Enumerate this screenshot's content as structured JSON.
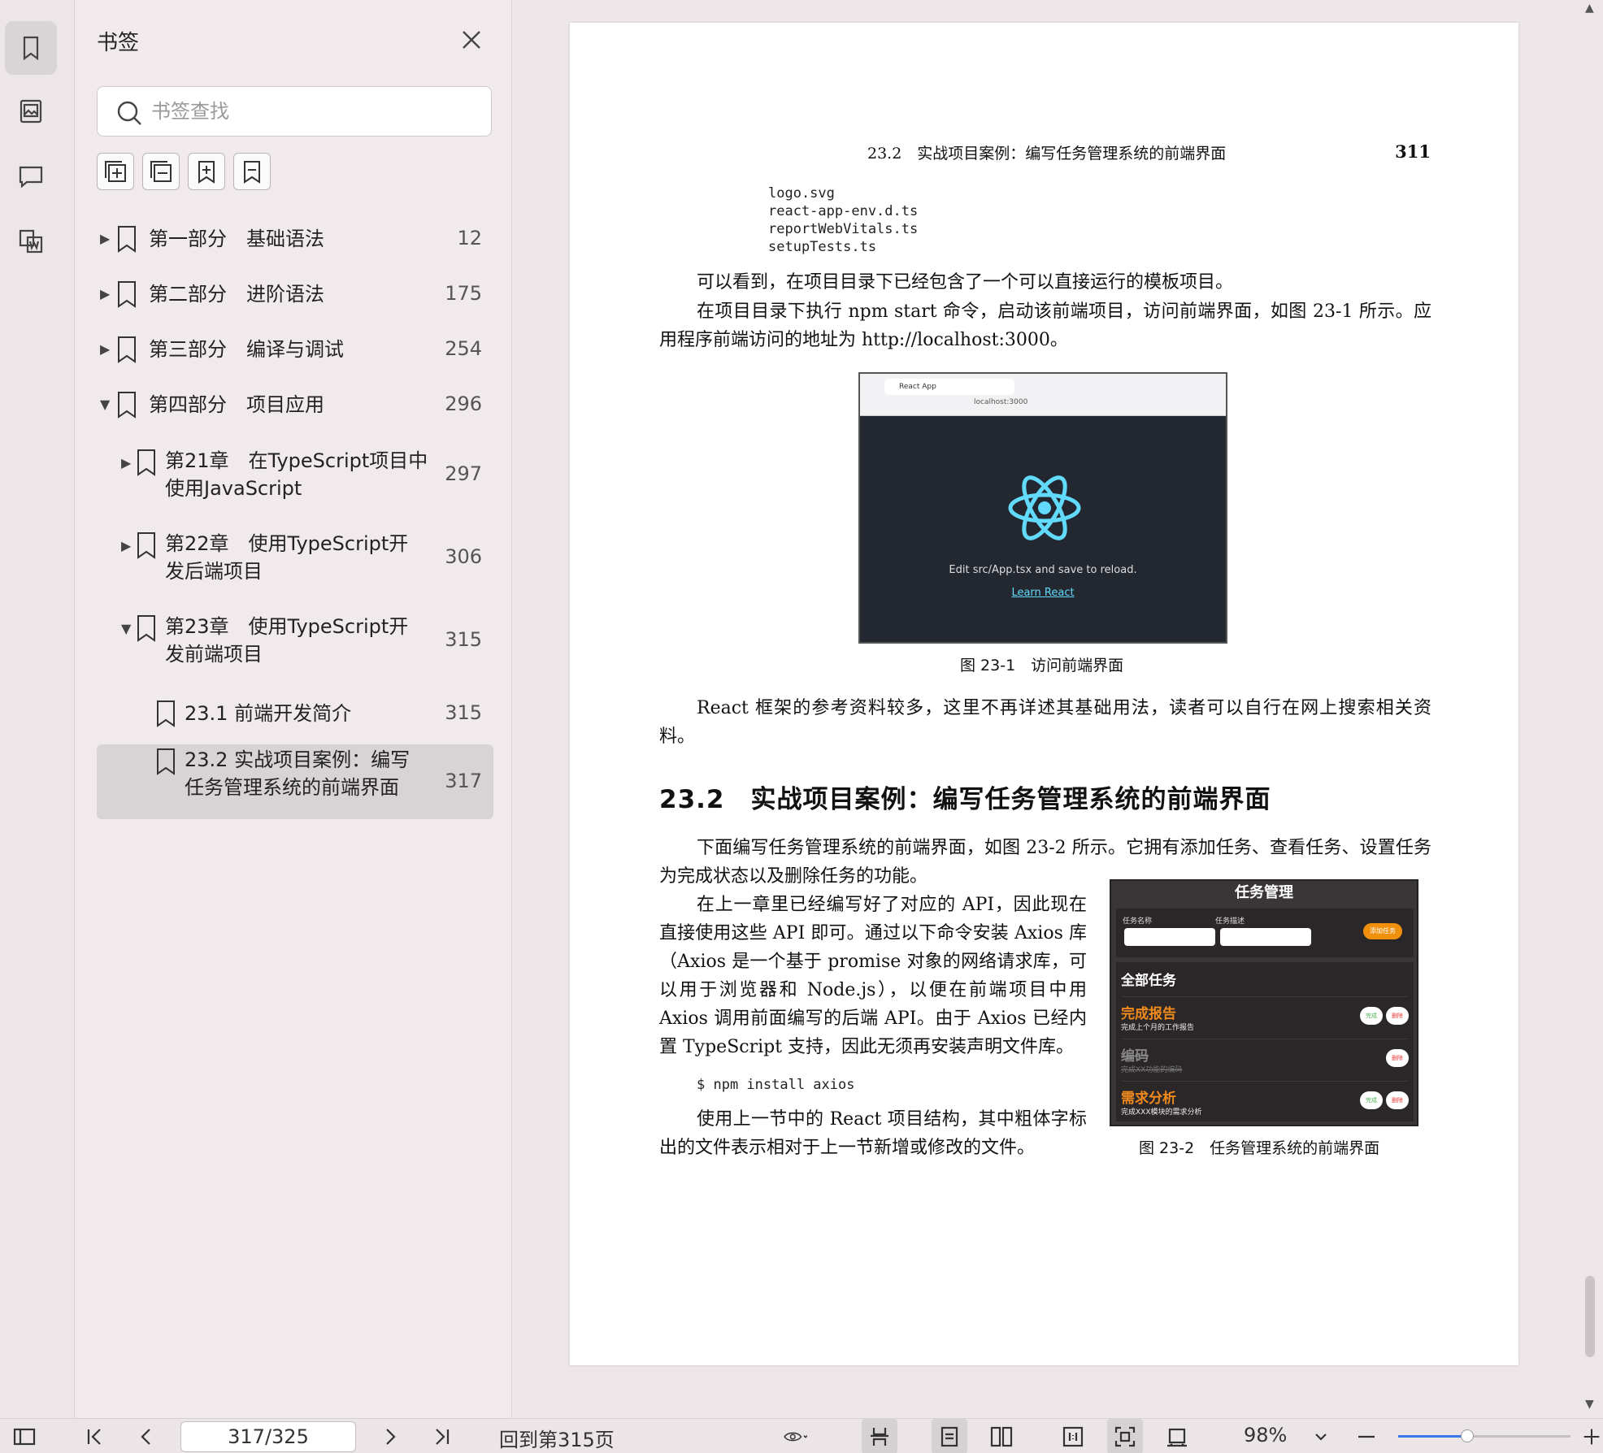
{
  "panel": {
    "title": "书签",
    "search_placeholder": "书签查找",
    "tree": [
      {
        "label": "第一部分　基础语法",
        "page": "12",
        "arrow": "right",
        "level": 0
      },
      {
        "label": "第二部分　进阶语法",
        "page": "175",
        "arrow": "right",
        "level": 0
      },
      {
        "label": "第三部分　编译与调试",
        "page": "254",
        "arrow": "right",
        "level": 0
      },
      {
        "label": "第四部分　项目应用",
        "page": "296",
        "arrow": "down",
        "level": 0
      },
      {
        "label": "第21章　在TypeScript项目中\n使用JavaScript",
        "page": "297",
        "arrow": "right",
        "level": 1
      },
      {
        "label": "第22章　使用TypeScript开\n发后端项目",
        "page": "306",
        "arrow": "right",
        "level": 1
      },
      {
        "label": "第23章　使用TypeScript开\n发前端项目",
        "page": "315",
        "arrow": "down",
        "level": 1
      },
      {
        "label": "23.1 前端开发简介",
        "page": "315",
        "arrow": "",
        "level": 2
      },
      {
        "label": "23.2 实战项目案例：编写\n任务管理系统的前端界面",
        "page": "317",
        "arrow": "",
        "level": 2,
        "selected": true
      }
    ]
  },
  "page": {
    "header": "23.2　实战项目案例：编写任务管理系统的前端界面",
    "number": "311",
    "code_lines": [
      "logo.svg",
      "react-app-env.d.ts",
      "reportWebVitals.ts",
      "setupTests.ts"
    ],
    "p1": "可以看到，在项目目录下已经包含了一个可以直接运行的模板项目。",
    "p2": "在项目目录下执行 npm start 命令，启动该前端项目，访问前端界面，如图 23-1 所示。应用程序前端访问的地址为 http://localhost:3000。",
    "fig1": {
      "tab": "React App",
      "url": "localhost:3000",
      "edit_text": "Edit src/App.tsx and save to reload.",
      "link": "Learn React",
      "caption": "图 23-1　访问前端界面"
    },
    "p3": "React 框架的参考资料较多，这里不再详述其基础用法，读者可以自行在网上搜索相关资料。",
    "section_title": "23.2　实战项目案例：编写任务管理系统的前端界面",
    "p4": "下面编写任务管理系统的前端界面，如图 23-2 所示。它拥有添加任务、查看任务、设置任务为完成状态以及删除任务的功能。",
    "p5": "在上一章里已经编写好了对应的 API，因此现在直接使用这些 API 即可。通过以下命令安装 Axios 库（Axios 是一个基于 promise 对象的网络请求库，可以用于浏览器和 Node.js），以便在前端项目中用 Axios 调用前面编写的后端 API。由于 Axios 已经内置 TypeScript 支持，因此无须再安装声明文件库。",
    "cmd": "$ npm install axios",
    "p6": "使用上一节中的 React 项目结构，其中粗体字标出的文件表示相对于上一节新增或修改的文件。",
    "fig2": {
      "title": "任务管理",
      "label_name": "任务名称",
      "label_desc": "任务描述",
      "add_btn": "添加任务",
      "all": "全部任务",
      "tasks": [
        {
          "name": "完成报告",
          "desc": "完成上个月的工作报告",
          "done": false
        },
        {
          "name": "编码",
          "desc": "完成XX功能的编码",
          "done": true
        },
        {
          "name": "需求分析",
          "desc": "完成XXX模块的需求分析",
          "done": false
        }
      ],
      "done_btn": "完成",
      "del_btn": "删除",
      "caption": "图 23-2　任务管理系统的前端界面"
    }
  },
  "bottombar": {
    "page_indicator": "317/325",
    "goto": "回到第315页",
    "zoom": "98%",
    "zoom_level": 0.4
  }
}
